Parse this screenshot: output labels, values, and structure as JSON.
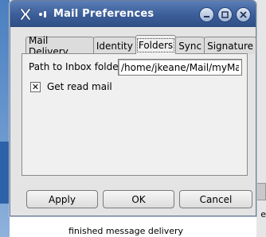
{
  "window": {
    "title": "Mail Preferences",
    "app_icon": "x-logo-icon",
    "controls": [
      "minimize-icon",
      "maximize-icon",
      "close-icon"
    ]
  },
  "tabs": [
    {
      "label": "Mail Delivery",
      "active": false
    },
    {
      "label": "Identity",
      "active": false
    },
    {
      "label": "Folders",
      "active": true
    },
    {
      "label": "Sync",
      "active": false
    },
    {
      "label": "Signature",
      "active": false
    }
  ],
  "folders": {
    "path_label": "Path to Inbox folder:",
    "path_value": "/home/jkeane/Mail/myMail",
    "get_read_mail_label": "Get read mail",
    "get_read_mail_checked": true,
    "check_mark": "✕"
  },
  "buttons": {
    "apply": "Apply",
    "ok": "OK",
    "cancel": "Cancel"
  },
  "background": {
    "text_line_1": "e",
    "text_line_2": "finished message delivery"
  },
  "colors": {
    "titlebar": "#3d5f9a",
    "dialog": "#e4e4e4",
    "desktop": "#4a7fbf"
  }
}
